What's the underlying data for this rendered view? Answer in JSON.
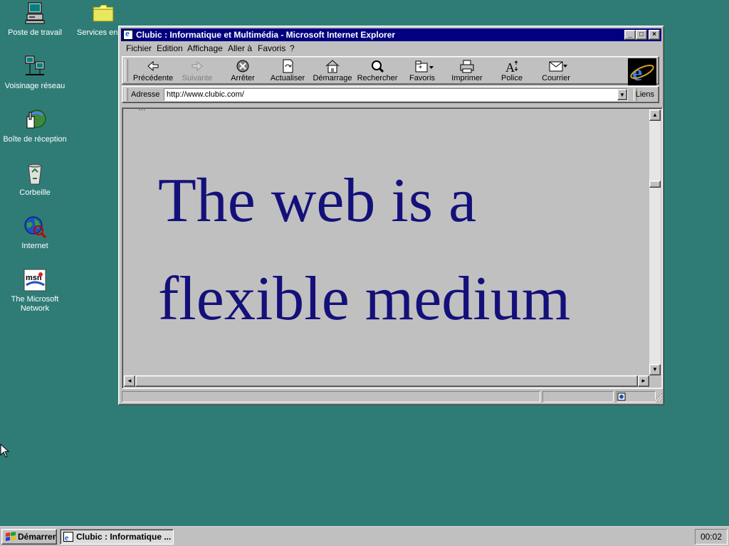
{
  "desktop": {
    "icons": [
      {
        "label": "Poste de travail",
        "icon": "computer-icon"
      },
      {
        "label": "Services en",
        "icon": "folder-icon"
      },
      {
        "label": "Voisinage réseau",
        "icon": "network-icon"
      },
      {
        "label": "Boîte de réception",
        "icon": "inbox-icon"
      },
      {
        "label": "Corbeille",
        "icon": "recycle-bin-icon"
      },
      {
        "label": "Internet",
        "icon": "internet-icon"
      },
      {
        "label": "The Microsoft Network",
        "icon": "msn-icon"
      }
    ],
    "background_color": "#2f7c77"
  },
  "window": {
    "title": "Clubic : Informatique et Multimédia - Microsoft Internet Explorer",
    "title_bar_color": "#000080",
    "controls": {
      "minimize": "_",
      "maximize": "□",
      "close": "×"
    },
    "menu": [
      "Fichier",
      "Edition",
      "Affichage",
      "Aller à",
      "Favoris",
      "?"
    ],
    "toolbar": [
      {
        "label": "Précédente",
        "icon": "back-arrow-icon",
        "enabled": true
      },
      {
        "label": "Suivante",
        "icon": "forward-arrow-icon",
        "enabled": false
      },
      {
        "label": "Arrêter",
        "icon": "stop-icon",
        "enabled": true
      },
      {
        "label": "Actualiser",
        "icon": "refresh-icon",
        "enabled": true
      },
      {
        "label": "Démarrage",
        "icon": "home-icon",
        "enabled": true
      },
      {
        "label": "Rechercher",
        "icon": "search-icon",
        "enabled": true
      },
      {
        "label": "Favoris",
        "icon": "favorites-icon",
        "enabled": true
      },
      {
        "label": "Imprimer",
        "icon": "print-icon",
        "enabled": true
      },
      {
        "label": "Police",
        "icon": "font-icon",
        "enabled": true
      },
      {
        "label": "Courrier",
        "icon": "mail-icon",
        "enabled": true
      }
    ],
    "address": {
      "label": "Adresse",
      "value": "http://www.clubic.com/",
      "links_label": "Liens"
    },
    "page": {
      "top_cut_text": "...",
      "headline": "The web is a flexible medium",
      "text_color": "#14107a",
      "background_color": "#c0c0c0"
    },
    "status": {
      "text": "",
      "zone": ""
    }
  },
  "taskbar": {
    "start_label": "Démarrer",
    "task_label": "Clubic : Informatique ...",
    "clock": "00:02"
  }
}
